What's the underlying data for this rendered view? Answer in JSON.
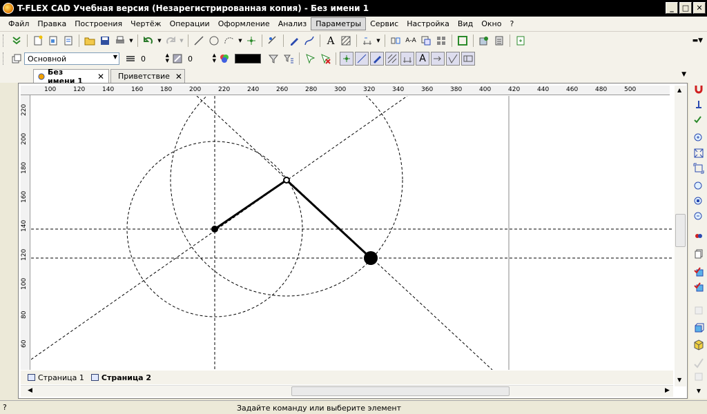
{
  "window": {
    "title": "T-FLEX CAD Учебная версия (Незарегистрированная копия) - Без имени 1"
  },
  "menu": [
    "Файл",
    "Правка",
    "Построения",
    "Чертёж",
    "Операции",
    "Оформление",
    "Анализ",
    "Параметры",
    "Сервис",
    "Настройка",
    "Вид",
    "Окно",
    "?"
  ],
  "menu_active": "Параметры",
  "toolbar2": {
    "layer": "Основной",
    "level": "0",
    "priority": "0",
    "color": "#000000"
  },
  "tabs": [
    {
      "label": "Без имени 1",
      "icon": "document-icon",
      "active": true
    },
    {
      "label": "Приветствие",
      "icon": "flag-icon",
      "active": false
    }
  ],
  "ruler": {
    "h_labels": [
      "100",
      "120",
      "140",
      "160",
      "180",
      "200",
      "220",
      "240",
      "260",
      "280",
      "300",
      "320",
      "340",
      "360",
      "380",
      "400",
      "420",
      "440",
      "460",
      "480",
      "500"
    ],
    "v_labels": [
      "220",
      "200",
      "180",
      "160",
      "140",
      "120",
      "100",
      "80",
      "60"
    ]
  },
  "pages": [
    {
      "label": "Страница 1",
      "active": false
    },
    {
      "label": "Страница 2",
      "active": true
    }
  ],
  "status": {
    "message": "Задайте команду или выберите элемент",
    "help": "?"
  }
}
